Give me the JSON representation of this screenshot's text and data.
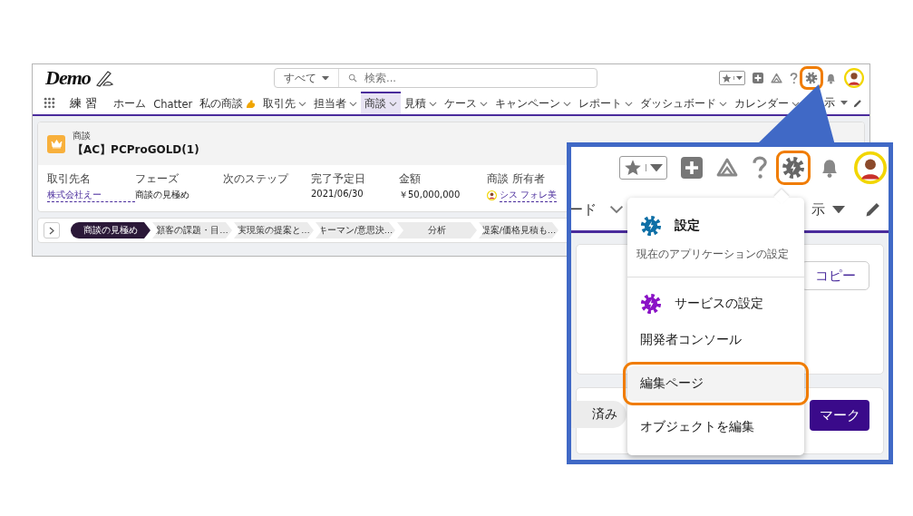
{
  "header": {
    "logo": "Demo",
    "search_scope": "すべて",
    "search_placeholder": "検索...",
    "gear_highlighted": true
  },
  "app_name": "練 習",
  "nav_tabs": [
    {
      "label": "ホーム",
      "has_menu": false,
      "has_icon": false,
      "selected": false
    },
    {
      "label": "Chatter",
      "has_menu": false,
      "has_icon": false,
      "selected": false
    },
    {
      "label": "私の商談",
      "has_menu": false,
      "has_icon": true,
      "selected": false
    },
    {
      "label": "取引先",
      "has_menu": true,
      "has_icon": false,
      "selected": false
    },
    {
      "label": "担当者",
      "has_menu": true,
      "has_icon": false,
      "selected": false
    },
    {
      "label": "商談",
      "has_menu": true,
      "has_icon": false,
      "selected": true
    },
    {
      "label": "見積",
      "has_menu": true,
      "has_icon": false,
      "selected": false
    },
    {
      "label": "ケース",
      "has_menu": true,
      "has_icon": false,
      "selected": false
    },
    {
      "label": "キャンペーン",
      "has_menu": true,
      "has_icon": false,
      "selected": false
    },
    {
      "label": "レポート",
      "has_menu": true,
      "has_icon": false,
      "selected": false
    },
    {
      "label": "ダッシュボード",
      "has_menu": true,
      "has_icon": false,
      "selected": false
    },
    {
      "label": "カレンダー",
      "has_menu": true,
      "has_icon": false,
      "selected": false
    }
  ],
  "nav_more": "示",
  "record": {
    "object_type": "商談",
    "title": "【AC】PCProGOLD(1)",
    "fields": [
      {
        "label": "取引先名",
        "value": "株式会社えー",
        "kind": "link"
      },
      {
        "label": "フェーズ",
        "value": "商談の見極め",
        "kind": "text"
      },
      {
        "label": "次のステップ",
        "kind": "text"
      },
      {
        "label": "完了予定日",
        "value": "2021/06/30",
        "kind": "text"
      },
      {
        "label": "金額",
        "value": "￥50,000,000",
        "kind": "text"
      },
      {
        "label": "商談 所有者",
        "value": "シス フォレ美",
        "kind": "user"
      }
    ]
  },
  "path_stages": [
    {
      "label": "商談の見極め",
      "selected": true
    },
    {
      "label": "顧客の課題・目…",
      "selected": false
    },
    {
      "label": "実現策の提案と…",
      "selected": false
    },
    {
      "label": "キーマン/意思決…",
      "selected": false
    },
    {
      "label": "分析",
      "selected": false
    },
    {
      "label": "提案/価格見積も…",
      "selected": false
    }
  ],
  "zoom_inset": {
    "gear_highlighted": true,
    "nav_left": "ード",
    "nav_right": "示",
    "copy_button": "コピー",
    "status_pill": "済み",
    "mark_button": "マーク",
    "menu": [
      {
        "kind": "icon",
        "label": "設定",
        "subtitle": "現在のアプリケーションの設定",
        "color": "#0e6fa6",
        "selected": false
      },
      {
        "kind": "icon",
        "label": "サービスの設定",
        "color": "#8a12c6",
        "selected": false
      },
      {
        "kind": "plain",
        "label": "開発者コンソール",
        "selected": false
      },
      {
        "kind": "plain",
        "label": "編集ページ",
        "selected": true
      },
      {
        "kind": "plain",
        "label": "オブジェクトを編集",
        "selected": false
      }
    ]
  }
}
